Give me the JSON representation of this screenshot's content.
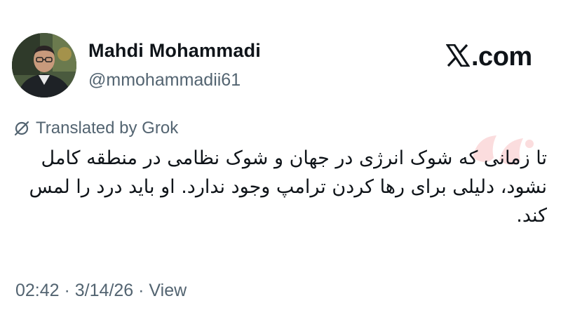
{
  "author": {
    "display_name": "Mahdi Mohammadi",
    "handle": "@mmohammadii61"
  },
  "brand": {
    "text": ".com",
    "icon": "x-logo-icon"
  },
  "translation": {
    "label": "Translated by Grok",
    "icon": "grok-icon"
  },
  "tweet": {
    "text": "تا زمانی که شوک انرژی در جهان و شوک نظامی در منطقه کامل نشود، دلیلی برای رها کردن ترامپ وجود ندارد. او باید درد را لمس کند."
  },
  "meta": {
    "time": "02:42",
    "sep1": " · ",
    "date": "3/14/26",
    "sep2": " · ",
    "view_label": "View"
  },
  "colors": {
    "text": "#0f1419",
    "secondary": "#536471",
    "watermark": "#e8434a"
  }
}
